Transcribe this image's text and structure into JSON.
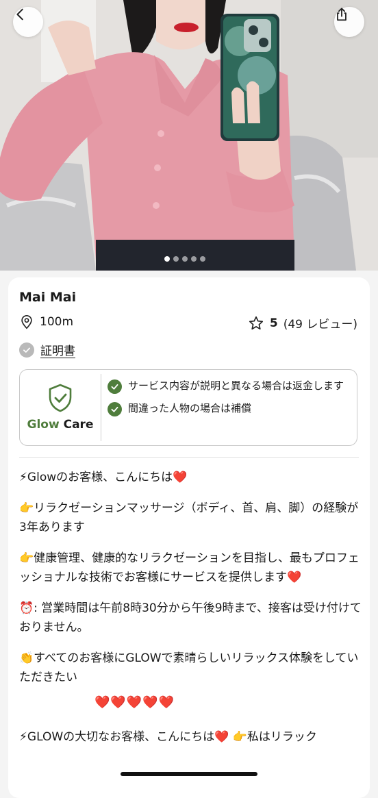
{
  "profile": {
    "name": "Mai Mai",
    "distance": "100m",
    "rating_score": "5",
    "rating_count": "(49 レビュー)",
    "certificate_label": "証明書"
  },
  "gallery": {
    "image_count": 5,
    "active_index": 0
  },
  "glow_care": {
    "brand_prefix": "Glow",
    "brand_suffix": "Care",
    "guarantees": [
      "サービス内容が説明と異なる場合は返金します",
      "間違った人物の場合は補償"
    ]
  },
  "description": {
    "line1": "⚡Glowのお客様、こんにちは❤️",
    "line2": "👉リラクゼーションマッサージ（ボディ、首、肩、脚）の経験が3年あります",
    "line3": "👉健康管理、健康的なリラクゼーションを目指し、最もプロフェッショナルな技術でお客様にサービスを提供します❤️",
    "line4": "⏰: 営業時間は午前8時30分から午後9時まで、接客は受け付けておりません。",
    "line5": "👏すべてのお客様にGLOWで素晴らしいリラックス体験をしていただきたい",
    "hearts": "❤️❤️❤️❤️❤️",
    "line6": "⚡GLOWの大切なお客様、こんにちは❤️ 👉私はリラック"
  },
  "icons": {
    "back": "chevron-left-icon",
    "share": "share-icon",
    "location": "location-pin-icon",
    "rating": "star-outline-icon",
    "certificate": "check-circle-icon",
    "glow_care": "shield-check-icon",
    "guarantee": "green-check-icon"
  },
  "colors": {
    "brand_green": "#4f7d3c",
    "heart_red": "#d81f26",
    "certificate_grey": "#b9b9b9"
  }
}
